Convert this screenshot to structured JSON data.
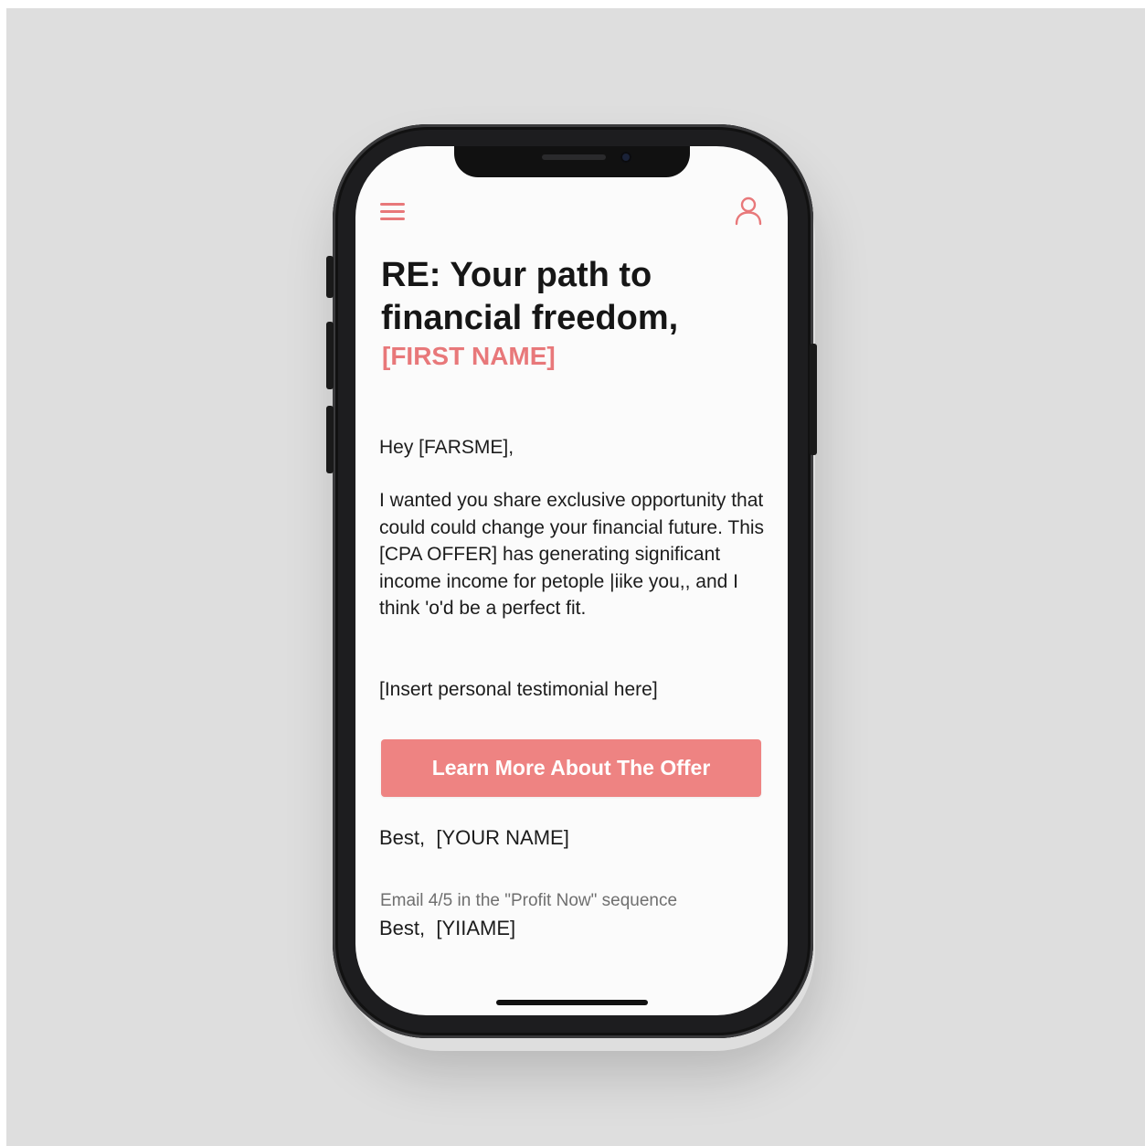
{
  "email": {
    "subject_line": "RE: Your path to financial freedom,",
    "subject_placeholder": "[FIRST NAME]",
    "greeting": "Hey [FARSME],",
    "paragraph": "I wanted you share exclusive opportunity that could could change your financial future. This [CPA OFFER] has generating significant income income for petople |iike you,, and I think 'o'd be a perfect fit.",
    "testimonial_placeholder": "[Insert personal testimonial here]",
    "cta_label": "Learn More About The Offer",
    "signoff": "Best,  [YOUR NAME]",
    "sequence_info": "Email 4/5 in the \"Profit Now\" sequence",
    "signoff_repeat": "Best,  [YIIAME]"
  },
  "icons": {
    "menu": "hamburger-menu-icon",
    "profile": "user-profile-icon"
  },
  "colors": {
    "accent": "#e8787a",
    "button": "#ee8382",
    "text": "#161616",
    "muted": "#6f6f6f",
    "background": "#dedede",
    "screen": "#fbfbfb"
  }
}
